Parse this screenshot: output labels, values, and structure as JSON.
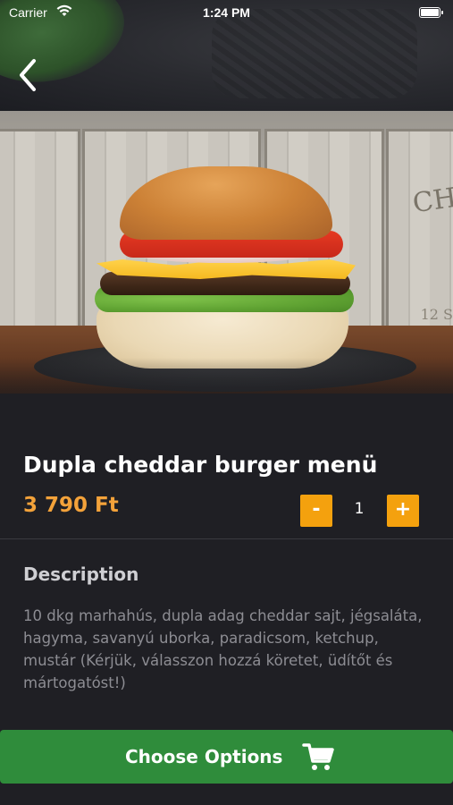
{
  "status_bar": {
    "carrier": "Carrier",
    "time": "1:24 PM",
    "wifi_icon": "wifi-icon",
    "battery_icon": "battery-icon"
  },
  "nav": {
    "back_icon": "chevron-left-icon"
  },
  "hero": {
    "image": "burger-photo",
    "crate_text": "CH",
    "crate_number": "12 S"
  },
  "product": {
    "title": "Dupla cheddar burger menü",
    "price": "3 790 Ft",
    "quantity": "1",
    "minus_label": "-",
    "plus_label": "+"
  },
  "description": {
    "heading": "Description",
    "text": "10 dkg marhahús, dupla adag cheddar sajt, jégsaláta, hagyma, savanyú uborka, paradicsom, ketchup, mustár (Kérjük, válasszon hozzá köretet, üdítőt és mártogatóst!)"
  },
  "action": {
    "choose_label": "Choose Options",
    "cart_icon": "shopping-cart-icon"
  },
  "colors": {
    "background": "#1f1f24",
    "price": "#f3a23a",
    "quantity_button": "#f4a10e",
    "primary_button": "#2f8c3b"
  }
}
